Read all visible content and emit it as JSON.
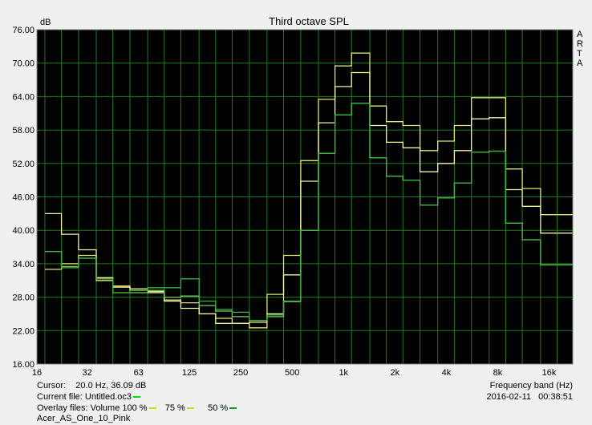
{
  "chart_data": {
    "type": "line",
    "title": "Third octave SPL",
    "ylabel": "dB",
    "xlabel": "Frequency band (Hz)",
    "ylim": [
      16,
      76
    ],
    "y_ticks": [
      "16.00",
      "22.00",
      "28.00",
      "34.00",
      "40.00",
      "46.00",
      "52.00",
      "58.00",
      "64.00",
      "70.00",
      "76.00"
    ],
    "x_tick_labels": [
      "16",
      "32",
      "63",
      "125",
      "250",
      "500",
      "1k",
      "2k",
      "4k",
      "8k",
      "16k"
    ],
    "bands": [
      20,
      25,
      31.5,
      40,
      50,
      63,
      80,
      100,
      125,
      160,
      200,
      250,
      315,
      400,
      500,
      630,
      800,
      1000,
      1250,
      1600,
      2000,
      2500,
      3150,
      4000,
      5000,
      6300,
      8000,
      10000,
      12500,
      16000,
      20000
    ],
    "grid": true,
    "series": [
      {
        "name": "Volume 100 %",
        "color": "#e5e56a",
        "values": [
          33,
          34,
          35.5,
          31,
          30,
          29.5,
          29,
          27.5,
          27,
          25,
          24.2,
          23.3,
          22.5,
          28.5,
          35.5,
          52.5,
          63.5,
          69.5,
          71.8,
          62.3,
          59.5,
          58.8,
          54.3,
          56,
          58.8,
          63.8,
          63.8,
          51,
          47.5,
          42.8,
          42.8
        ]
      },
      {
        "name": "Untitled.oc3",
        "color": "#f5f5a0",
        "values": [
          43,
          39.3,
          36.5,
          31.5,
          29.8,
          29.2,
          28.8,
          27.3,
          26,
          25,
          23.3,
          23.3,
          23.5,
          25,
          32,
          48.8,
          59.3,
          65.8,
          68.3,
          58.8,
          55.8,
          54.8,
          50.5,
          52,
          54.3,
          60,
          60.2,
          47.3,
          44.3,
          39.5,
          39.5
        ]
      },
      {
        "name": "Acer_AS_One_10_Pink",
        "color": "#78c878",
        "values": [
          36.2,
          33.5,
          35,
          31.3,
          28.8,
          28.8,
          29.2,
          28,
          28.2,
          26.5,
          25.5,
          24.5,
          23.8,
          24.5,
          27.3,
          40,
          53.8,
          60.7,
          62.8,
          53,
          49.7,
          49,
          44.5,
          45.8,
          48.5,
          54,
          54.2,
          41.3,
          38.3,
          33.8,
          33.8
        ]
      },
      {
        "name": "50 %",
        "color": "#3cb43c",
        "values": [
          36.2,
          33.3,
          35,
          31.3,
          28.8,
          29.2,
          29.7,
          29.7,
          31.3,
          27.3,
          25.8,
          25.3,
          23.8,
          24.8,
          27.2,
          40,
          53.8,
          60.7,
          62.8,
          53,
          49.7,
          49,
          44.5,
          45.8,
          48.5,
          54,
          54.2,
          41.3,
          38.3,
          33.8,
          33.8
        ]
      }
    ]
  },
  "side_label_letters": [
    "A",
    "R",
    "T",
    "A"
  ],
  "footer": {
    "cursor": "Cursor:    20.0 Hz, 36.09 dB",
    "current_file_label": "Current file: ",
    "current_file_name": "Untitled.oc3",
    "current_file_color": "#00e000",
    "overlay_label": "Overlay files: Volume 100 %",
    "overlay_100_color": "#d8d800",
    "overlay_75_label": "75 %",
    "overlay_75_color": "#d8d800",
    "overlay_50_label": "50 %",
    "overlay_50_color": "#00a000",
    "overlay_file": "Acer_AS_One_10_Pink",
    "datetime": "2016-02-11   00:38:51"
  }
}
